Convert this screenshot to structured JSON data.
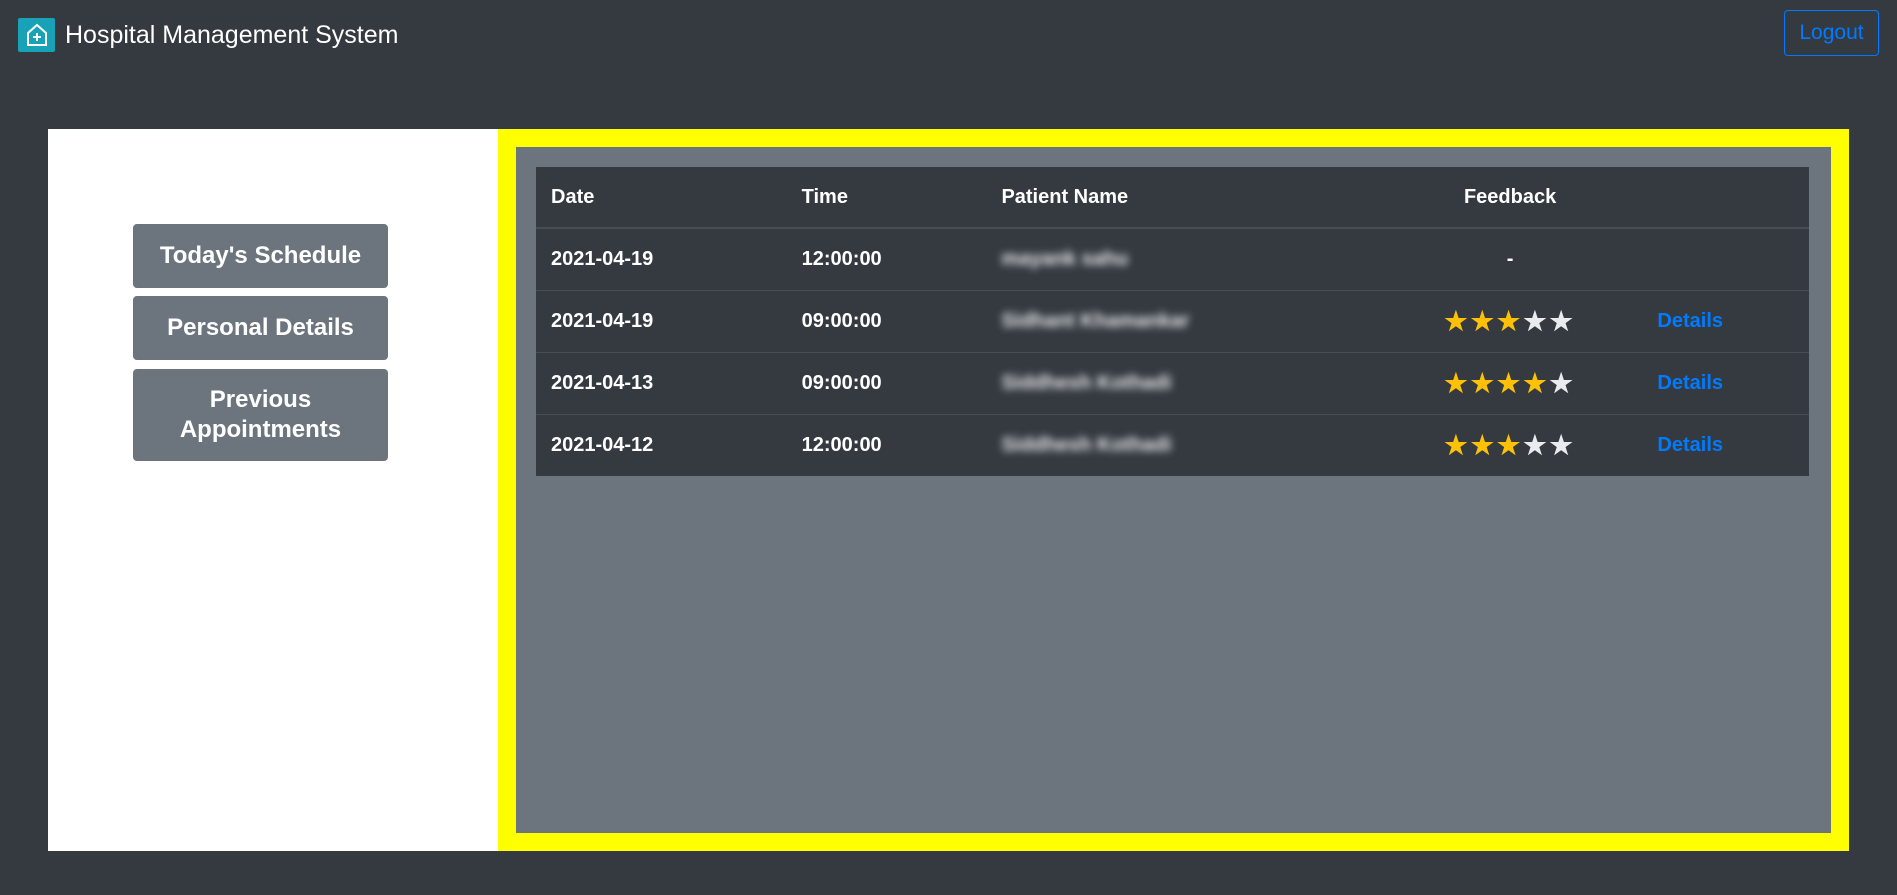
{
  "app": {
    "title": "Hospital Management System",
    "logo_icon": "hospital-icon"
  },
  "header": {
    "logout_label": "Logout"
  },
  "sidebar": {
    "items": [
      {
        "label": "Today's Schedule"
      },
      {
        "label": "Personal Details"
      },
      {
        "label": "Previous Appointments"
      }
    ]
  },
  "table": {
    "headers": {
      "date": "Date",
      "time": "Time",
      "patient": "Patient Name",
      "feedback": "Feedback"
    },
    "rows": [
      {
        "date": "2021-04-19",
        "time": "12:00:00",
        "patient": "mayank sahu",
        "feedback": "-",
        "rating": null,
        "details": ""
      },
      {
        "date": "2021-04-19",
        "time": "09:00:00",
        "patient": "Sidhant Khamankar",
        "feedback": "",
        "rating": 3,
        "details": "Details"
      },
      {
        "date": "2021-04-13",
        "time": "09:00:00",
        "patient": "Siddhesh Kothadi",
        "feedback": "",
        "rating": 4,
        "details": "Details"
      },
      {
        "date": "2021-04-12",
        "time": "12:00:00",
        "patient": "Siddhesh Kothadi",
        "feedback": "",
        "rating": 3,
        "details": "Details"
      }
    ],
    "max_rating": 5
  },
  "colors": {
    "accent": "#007bff",
    "highlight": "#ffff00",
    "star": "#ffc107",
    "background": "#343a40"
  }
}
